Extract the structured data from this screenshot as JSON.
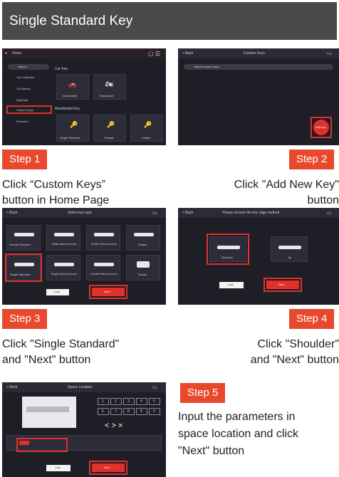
{
  "header": {
    "title": "Single Standard Key"
  },
  "shot1": {
    "app": "Home",
    "search": "Search",
    "sidebar": [
      "Car Collection",
      "Cut History",
      "Duplicate",
      "Custom Keys",
      "Favorites"
    ],
    "sections": [
      "Car Key",
      "Residential Key"
    ],
    "car_tiles": [
      "Automobile",
      "Motorcycle"
    ],
    "res_tiles": [
      "Single Standard",
      "Tubular",
      "Dimple"
    ]
  },
  "shot2": {
    "back": "< Back",
    "title": "Custom Keys",
    "search": "Search custom keys",
    "add": "Add key"
  },
  "shot3": {
    "back": "< Back",
    "title": "Select key type",
    "types": [
      "Double Standard",
      "Single Internal Groove",
      "Double Internal Groove",
      "Dimple",
      "Single Standard",
      "Single External Groove",
      "Double External Groove",
      "Tubular"
    ],
    "prev": "Last",
    "next": "Next"
  },
  "shot4": {
    "back": "< Back",
    "title": "Please choose the key align method",
    "options": [
      "Shoulder",
      "Tip"
    ],
    "prev": "Last",
    "next": "Next"
  },
  "shot5": {
    "back": "< Back",
    "title": "Space Location",
    "numbers": [
      "1",
      "2",
      "3",
      "4",
      "5",
      "6",
      "7",
      "8",
      "9",
      "0"
    ],
    "nav": "< > ×",
    "prev": "Last",
    "next": "Next"
  },
  "steps": [
    {
      "label": "Step 1",
      "caption": "Click “Custom Keys”\nbutton in Home Page"
    },
    {
      "label": "Step 2",
      "caption": "Click \"Add New Key\"\nbutton"
    },
    {
      "label": "Step 3",
      "caption": "Click \"Single Standard\"\nand \"Next\" button"
    },
    {
      "label": "Step 4",
      "caption": "Click \"Shoulder\"\nand \"Next\" button"
    },
    {
      "label": "Step 5",
      "caption": "Input the parameters in\nspace location and click\n\"Next\" button"
    }
  ]
}
